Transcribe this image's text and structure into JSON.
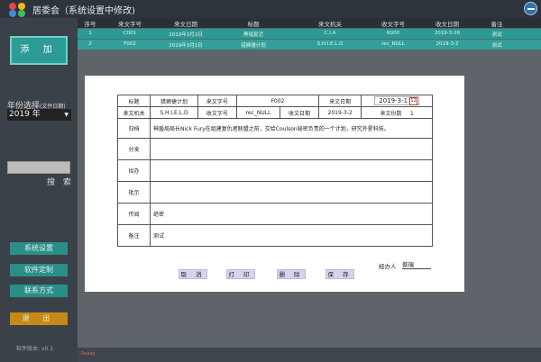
{
  "app": {
    "title": "居委会（系统设置中修改)"
  },
  "sidebar": {
    "add_label": "添 加",
    "year_label": "年份选择",
    "year_hint": "(文件日期)",
    "year_value": "2019 年",
    "search_placeholder": "",
    "search_label": "搜 索",
    "buttons": [
      "系统设置",
      "软件定制",
      "联系方式"
    ],
    "exit_label": "退 出",
    "version": "软件版本: v0.1"
  },
  "table": {
    "headers": [
      "序号",
      "来文字号",
      "来文日期",
      "标题",
      "来文机关",
      "收文字号",
      "收文日期",
      "备注"
    ],
    "rows": [
      [
        "1",
        "C001",
        "2019年3月2日",
        "黑暗复活",
        "C.I.A",
        "R000",
        "2019-3-26",
        "测试"
      ],
      [
        "2",
        "F002",
        "2019年3月1日",
        "猎狮捷计划",
        "S.H.I.E.L.D",
        "rec_NULL",
        "2019-3-2",
        "测试"
      ]
    ]
  },
  "document": {
    "labels": {
      "title": "标题",
      "doc_no": "来文字号",
      "doc_date": "来文日期",
      "agency": "来文机关",
      "recv_no": "收文字号",
      "recv_date": "收文日期",
      "copies": "来文份数",
      "archive": "归档",
      "dispatch": "分发",
      "draft": "拟办",
      "instruct": "批示",
      "circulate": "传阅",
      "remark": "备注"
    },
    "title": "猎狮捷计划",
    "doc_no": "F002",
    "doc_date": "2019-3-1",
    "calendar_day": "12",
    "agency": "S.H.I.E.L.D",
    "recv_no": "rec_NULL",
    "recv_date": "2019-3-2",
    "copies": "1",
    "archive": "神盾局局长Nick Fury在组建复仇者联盟之前，交给Coulson秘密负责的一个计划，研究外星科技。",
    "dispatch": "",
    "draft": "",
    "instruct": "",
    "circulate": "绝密",
    "remark": "测试",
    "buttons": {
      "cancel": "取 消",
      "print": "打 印",
      "delete": "删 除",
      "save": "保 存"
    },
    "handler_label": "经办人",
    "handler_value": "蔡瑞"
  },
  "status": {
    "text": "Ready"
  },
  "colors": {
    "accent": "#2a9a94",
    "exit": "#c58a16",
    "sidebar": "#3a4148"
  }
}
